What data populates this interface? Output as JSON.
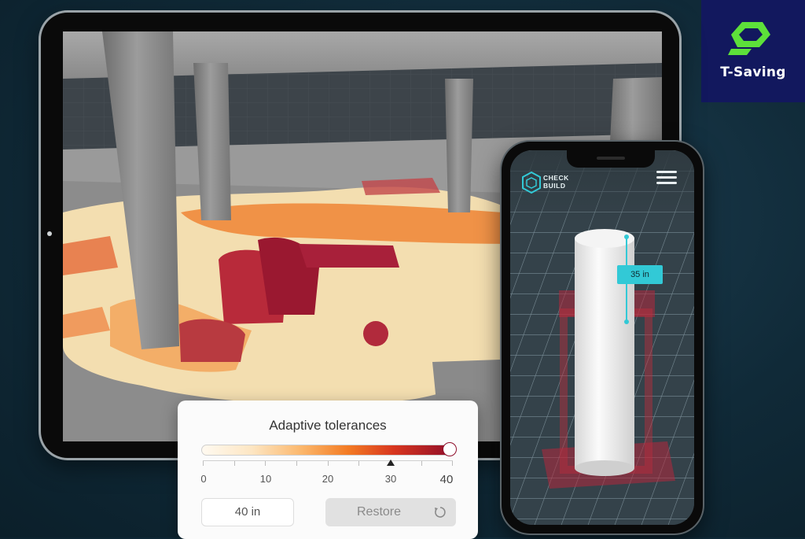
{
  "brand": {
    "name": "T-Saving",
    "logo_icon": "hexagon-bolt-icon",
    "accent": "#5de03a",
    "bg": "#12185e"
  },
  "app": {
    "logo_line1": "CHECK",
    "logo_line2": "BUILD",
    "logo_icon": "hexagon-cube-icon",
    "menu_icon": "hamburger-menu-icon"
  },
  "measurement": {
    "label": "35 in"
  },
  "panel": {
    "title": "Adaptive tolerances",
    "ticks": [
      "0",
      "10",
      "20",
      "30",
      "40"
    ],
    "selected_fraction": 0.75,
    "input_value": "40 in",
    "restore_label": "Restore",
    "restore_icon": "undo-icon",
    "gradient_colors": [
      "#fffaf1",
      "#fbb66a",
      "#f37b24",
      "#d8361f",
      "#8e0d2a"
    ]
  }
}
